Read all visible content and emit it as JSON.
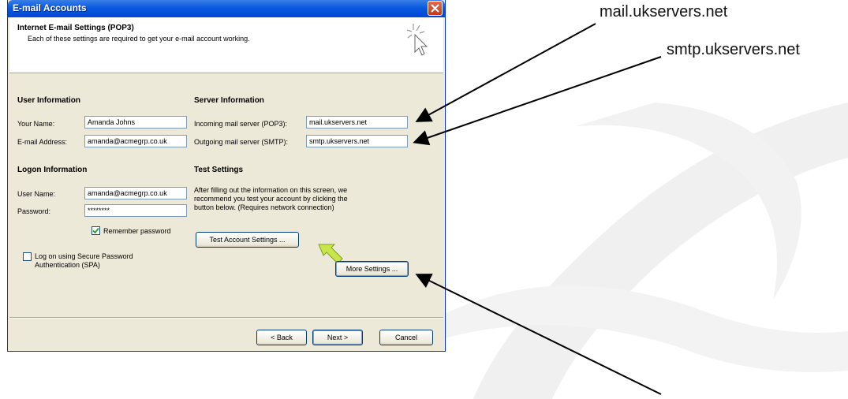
{
  "window": {
    "title": "E-mail Accounts",
    "header_title": "Internet E-mail Settings (POP3)",
    "header_subtitle": "Each of these settings are required to get your e-mail account working."
  },
  "user_info": {
    "heading": "User Information",
    "name_label": "Your Name:",
    "name_value": "Amanda Johns",
    "email_label": "E-mail Address:",
    "email_value": "amanda@acmegrp.co.uk"
  },
  "server_info": {
    "heading": "Server Information",
    "incoming_label": "Incoming mail server (POP3):",
    "incoming_value": "mail.ukservers.net",
    "outgoing_label": "Outgoing mail server (SMTP):",
    "outgoing_value": "smtp.ukservers.net"
  },
  "logon_info": {
    "heading": "Logon Information",
    "username_label": "User Name:",
    "username_value": "amanda@acmegrp.co.uk",
    "password_label": "Password:",
    "password_value": "********",
    "remember_label": "Remember password",
    "remember_checked": true,
    "spa_label_1": "Log on using Secure Password",
    "spa_label_2": "Authentication (SPA)",
    "spa_checked": false
  },
  "test_settings": {
    "heading": "Test Settings",
    "note_1": "After filling out the information on this screen, we",
    "note_2": "recommend you test your account by clicking the",
    "note_3": "button below. (Requires network connection)",
    "test_button": "Test Account Settings ...",
    "more_button": "More Settings ..."
  },
  "footer": {
    "back": "< Back",
    "next": "Next >",
    "cancel": "Cancel"
  },
  "callouts": {
    "incoming": "mail.ukservers.net",
    "outgoing": "smtp.ukservers.net"
  },
  "colors": {
    "titlebar": "#0a5ae0",
    "dialog_bg": "#ece9d8",
    "arrow_green": "#c8e64c"
  }
}
